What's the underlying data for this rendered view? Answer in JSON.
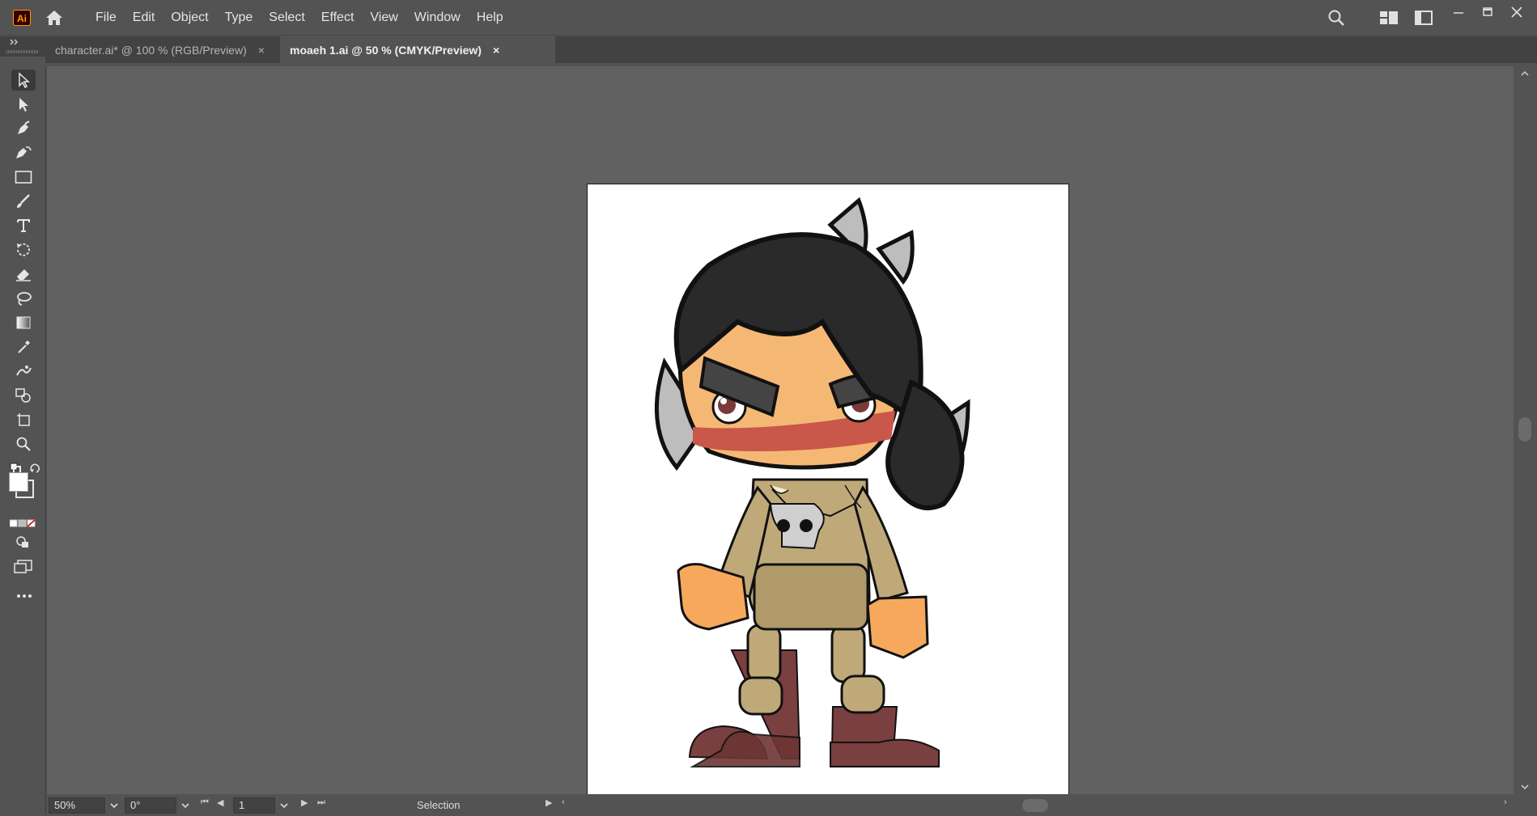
{
  "app": {
    "logo": "Ai"
  },
  "menu": {
    "items": [
      "File",
      "Edit",
      "Object",
      "Type",
      "Select",
      "Effect",
      "View",
      "Window",
      "Help"
    ]
  },
  "tabs": [
    {
      "label": "character.ai* @ 100 % (RGB/Preview)",
      "close": "×",
      "active": false
    },
    {
      "label": "moaeh 1.ai @ 50 % (CMYK/Preview)",
      "close": "×",
      "active": true
    }
  ],
  "tools": [
    "selection-tool-icon",
    "direct-selection-tool-icon",
    "pen-tool-icon",
    "curvature-tool-icon",
    "rectangle-tool-icon",
    "paintbrush-tool-icon",
    "type-tool-icon",
    "rotate-tool-icon",
    "eraser-tool-icon",
    "lasso-tool-icon",
    "gradient-tool-icon",
    "eyedropper-tool-icon",
    "puppet-warp-tool-icon",
    "shape-builder-tool-icon",
    "artboard-tool-icon",
    "zoom-tool-icon"
  ],
  "statusbar": {
    "zoom": "50%",
    "rotation": "0°",
    "artboard_number": "1",
    "tool_name": "Selection"
  },
  "colors": {
    "chrome": "#535353",
    "canvas": "#616161",
    "artboard": "#ffffff",
    "accent_logo": "#ff9a00"
  }
}
